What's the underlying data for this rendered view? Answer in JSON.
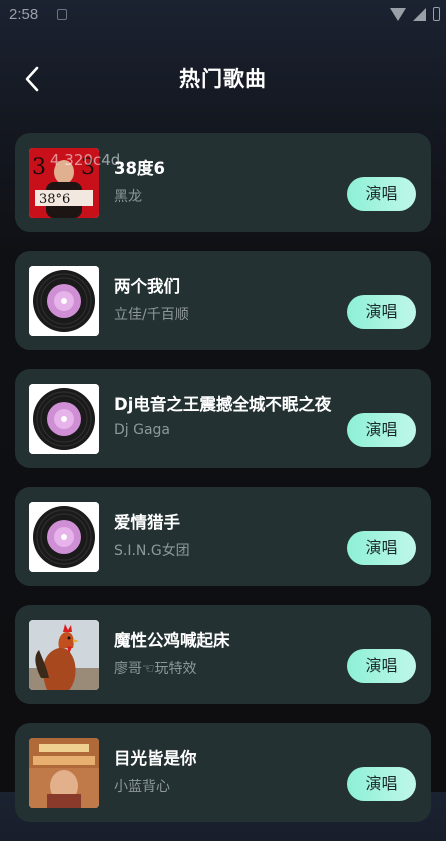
{
  "status": {
    "time": "2:58"
  },
  "header": {
    "title": "热门歌曲"
  },
  "overlay": {
    "text": "4  320c4d"
  },
  "button_label": "演唱",
  "songs": [
    {
      "name": "38度6",
      "artist": "黑龙",
      "cover": "album-art-38du6"
    },
    {
      "name": "两个我们",
      "artist": "立佳/千百顺",
      "cover": "vinyl-record"
    },
    {
      "name": "Dj电音之王震撼全城不眠之夜",
      "artist": "Dj Gaga",
      "cover": "vinyl-record"
    },
    {
      "name": "爱情猎手",
      "artist": "S.I.N.G女团",
      "cover": "vinyl-record"
    },
    {
      "name": "魔性公鸡喊起床",
      "artist": "廖哥☜玩特效",
      "cover": "rooster-photo"
    },
    {
      "name": "目光皆是你",
      "artist": "小蓝背心",
      "cover": "album-art-muguang"
    }
  ],
  "colors": {
    "card_bg": "#233132",
    "button_gradient_start": "#8ef0d6",
    "button_gradient_end": "#bff7ea"
  }
}
